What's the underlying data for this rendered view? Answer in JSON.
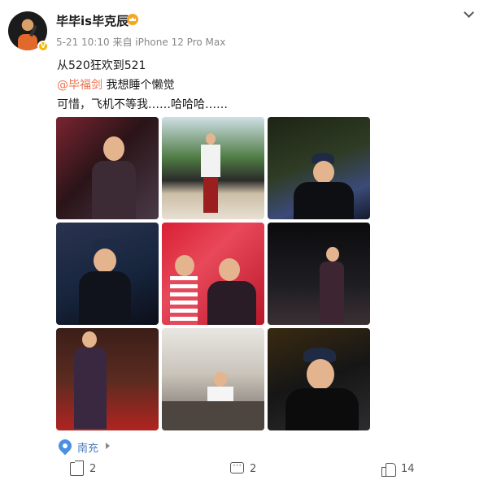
{
  "post": {
    "username": "毕毕is毕克辰",
    "meta": "5-21 10:10 来自 iPhone 12 Pro Max",
    "text_line1": "从520狂欢到521",
    "mention": "@毕福剑",
    "text_line2_rest": " 我想睡个懒觉",
    "text_line3": "可惜，飞机不等我……哈哈哈……",
    "verified_badge": "V"
  },
  "photos": [
    {
      "name": "photo-1",
      "icon": "image-icon"
    },
    {
      "name": "photo-2",
      "icon": "image-icon"
    },
    {
      "name": "photo-3",
      "icon": "image-icon"
    },
    {
      "name": "photo-4",
      "icon": "image-icon"
    },
    {
      "name": "photo-5",
      "icon": "image-icon"
    },
    {
      "name": "photo-6",
      "icon": "image-icon"
    },
    {
      "name": "photo-7",
      "icon": "image-icon"
    },
    {
      "name": "photo-8",
      "icon": "image-icon"
    },
    {
      "name": "photo-9",
      "icon": "image-icon"
    }
  ],
  "location": {
    "label": "南充",
    "icon": "location-pin-icon"
  },
  "actions": {
    "share_count": "2",
    "comment_count": "2",
    "like_count": "14"
  },
  "colors": {
    "mention": "#eb7350",
    "location": "#4a7ab8",
    "badge": "#f2b705"
  }
}
